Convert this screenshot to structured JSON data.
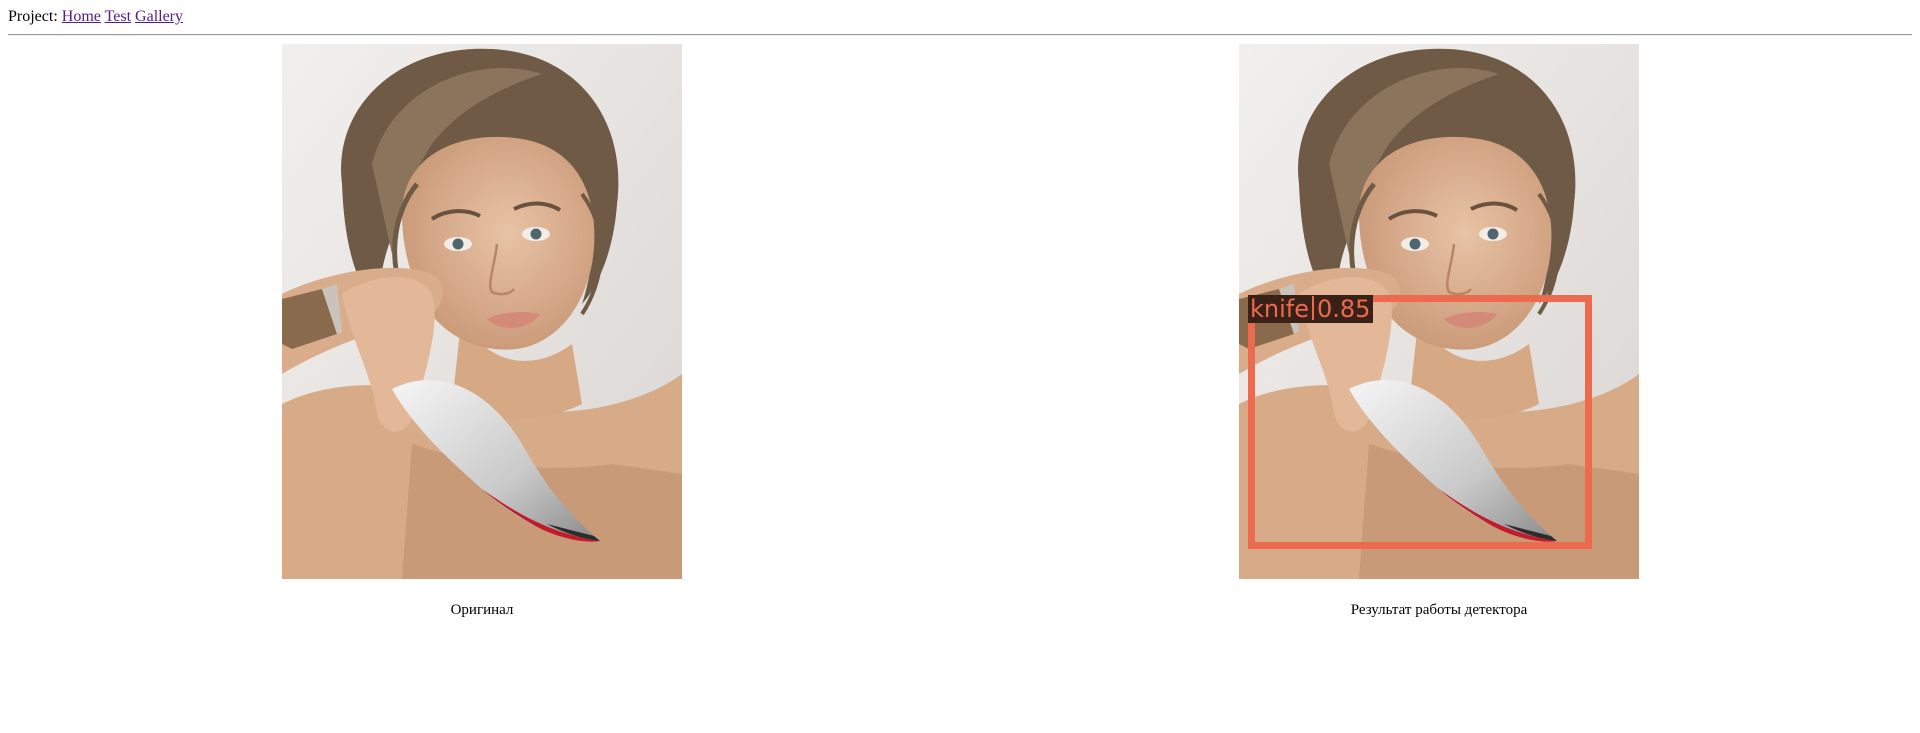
{
  "nav": {
    "prefix": "Project:",
    "links": [
      {
        "label": "Home"
      },
      {
        "label": "Test"
      },
      {
        "label": "Gallery"
      }
    ]
  },
  "panels": {
    "original": {
      "caption": "Оригинал"
    },
    "detected": {
      "caption": "Результат работы детектора",
      "detection": {
        "class_name": "knife",
        "score": "0.85",
        "box_color": "#ec6b4e"
      }
    }
  }
}
